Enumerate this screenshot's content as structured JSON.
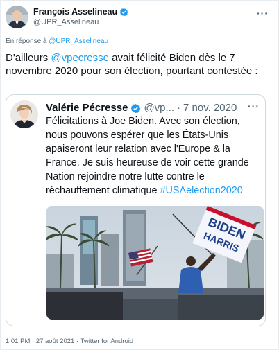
{
  "author": {
    "name": "François Asselineau",
    "handle": "@UPR_Asselineau",
    "verified": true,
    "more_icon": "more-icon"
  },
  "reply": {
    "prefix": "En réponse à ",
    "mention": "@UPR_Asselineau"
  },
  "tweet": {
    "text_before": "D'ailleurs ",
    "mention": "@vpecresse",
    "text_after": " avait félicité Biden dès le 7 novembre 2020 pour son élection, pourtant contestée :"
  },
  "quoted": {
    "name": "Valérie Pécresse",
    "handle": "@vp...",
    "separator": "·",
    "date": "7 nov. 2020",
    "verified": true,
    "text": "Félicitations à Joe Biden. Avec son élection, nous pouvons espérer que les États-Unis apaiseront leur relation avec l'Europe & la France. Je suis heureuse de voir cette grande Nation rejoindre notre lutte contre le réchauffement climatique ",
    "hashtag": "#USAelection2020",
    "image": {
      "sign_line1": "BIDEN",
      "sign_line2": "HARRIS"
    }
  },
  "footer": {
    "meta": "1:01 PM · 27 août 2021 · Twitter for Android"
  },
  "colors": {
    "link": "#1d9bf0",
    "secondary_text": "#536471",
    "border": "#cfd9de"
  }
}
